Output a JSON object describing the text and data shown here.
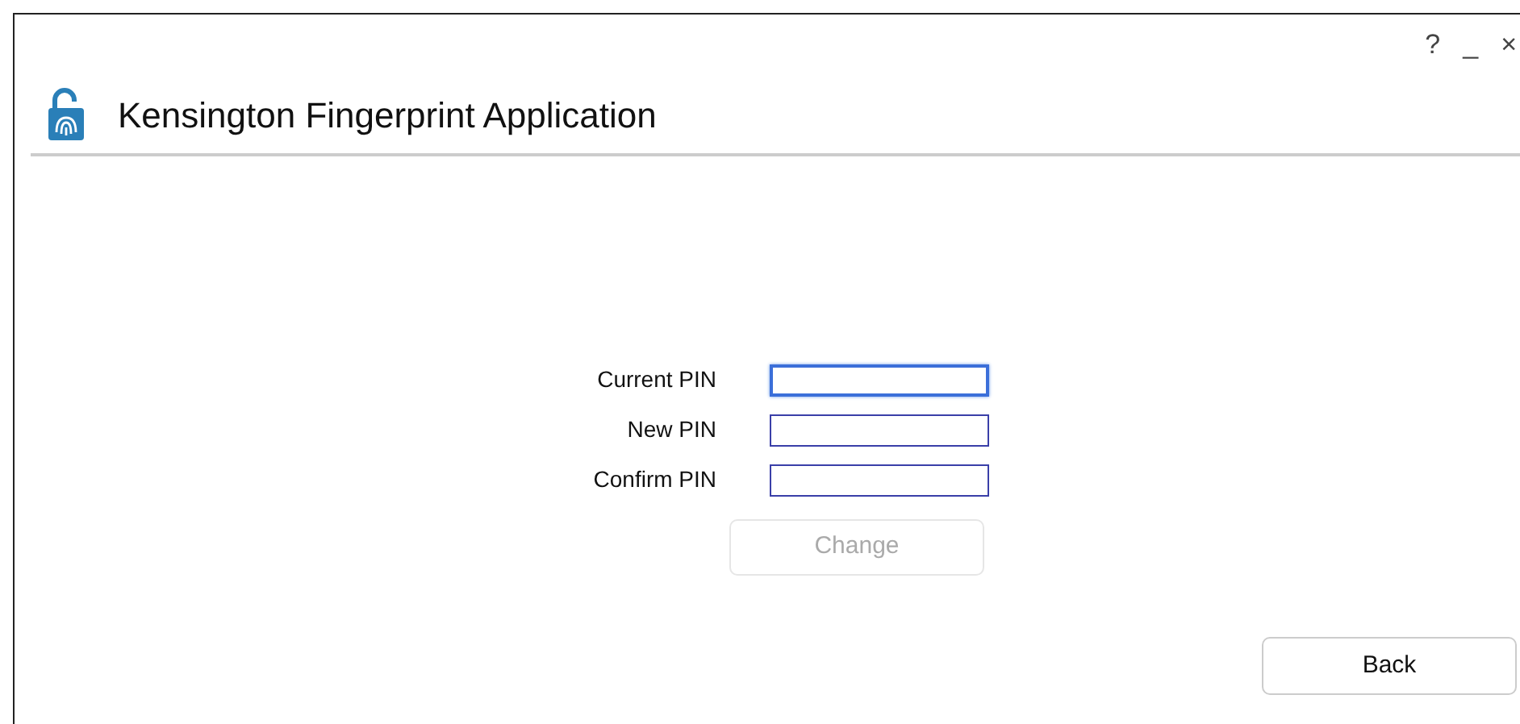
{
  "window": {
    "title": "Kensington Fingerprint Application",
    "controls": [
      "?",
      "_",
      "×"
    ]
  },
  "form": {
    "fields": [
      {
        "label": "Current PIN",
        "focused": true
      },
      {
        "label": "New PIN",
        "focused": false
      },
      {
        "label": "Confirm PIN",
        "focused": false
      }
    ],
    "submit": {
      "label": "Change",
      "disabled": true
    }
  },
  "back_button": {
    "label": "Back"
  }
}
